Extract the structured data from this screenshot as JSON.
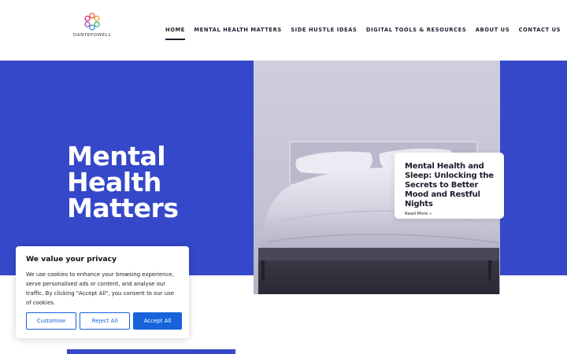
{
  "site": {
    "logo_text": "DANTEPOWELL",
    "logo_icon": "flower-ring-logo"
  },
  "nav": {
    "items": [
      {
        "label": "HOME",
        "active": true
      },
      {
        "label": "MENTAL HEALTH MATTERS",
        "active": false
      },
      {
        "label": "SIDE HUSTLE IDEAS",
        "active": false
      },
      {
        "label": "DIGITAL TOOLS & RESOURCES",
        "active": false
      },
      {
        "label": "ABOUT US",
        "active": false
      },
      {
        "label": "CONTACT US",
        "active": false
      }
    ]
  },
  "hero": {
    "title_lines": [
      "Mental",
      "Health",
      "Matters"
    ],
    "image_icon": "bed-photo",
    "accent_color": "#3548c9"
  },
  "card": {
    "title": "Mental Health and Sleep: Unlocking the Secrets to Better Mood and Restful Nights",
    "link": "Read More »"
  },
  "cookie": {
    "title": "We value your privacy",
    "text": "We use cookies to enhance your browsing experience, serve personalised ads or content, and analyse our traffic. By clicking \"Accept All\", you consent to our use of cookies.",
    "buttons": {
      "customise": "Customise",
      "reject": "Reject All",
      "accept": "Accept All"
    },
    "button_color": "#1863dc"
  }
}
